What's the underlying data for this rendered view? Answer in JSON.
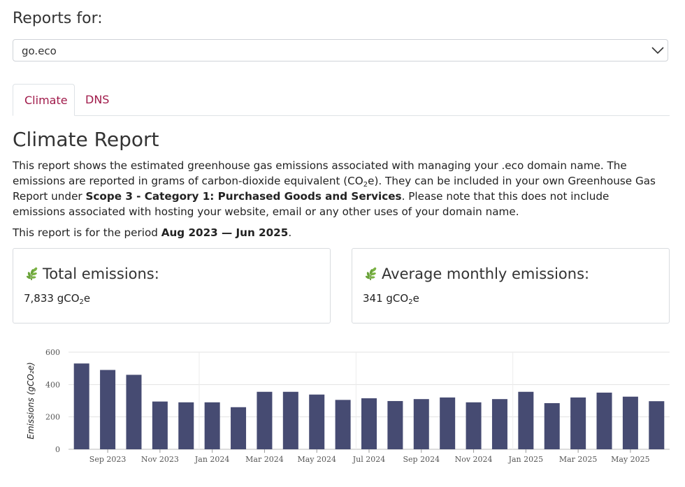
{
  "header": {
    "reports_label": "Reports for:"
  },
  "domain_select": {
    "value": "go.eco",
    "chevron_icon": "chevron-down-icon"
  },
  "tabs": [
    {
      "label": "Climate",
      "active": true
    },
    {
      "label": "DNS",
      "active": false
    }
  ],
  "report": {
    "title": "Climate Report",
    "desc_part1": "This report shows the estimated greenhouse gas emissions associated with managing your .eco domain name. The emissions are reported in grams of carbon-dioxide equivalent (CO",
    "desc_sub": "2",
    "desc_part2": "e). They can be included in your own Greenhouse Gas Report under ",
    "desc_bold": "Scope 3 - Category 1: Purchased Goods and Services",
    "desc_part3": ". Please note that this does not include emissions associated with hosting your website, email or any other uses of your domain name.",
    "period_prefix": "This report is for the period ",
    "period_value": "Aug 2023 — Jun 2025",
    "period_suffix": "."
  },
  "cards": {
    "leaf_icon": "leaf-icon",
    "total": {
      "title": "Total emissions:",
      "value": "7,833 gCO",
      "sub": "2",
      "suffix": "e"
    },
    "average": {
      "title": "Average monthly emissions:",
      "value": "341 gCO",
      "sub": "2",
      "suffix": "e"
    }
  },
  "colors": {
    "accent": "#a01a4a",
    "bar": "#464b72"
  },
  "chart_data": {
    "type": "bar",
    "ylabel": "Emissions (gCO₂e)",
    "ylim": [
      0,
      600
    ],
    "yticks": [
      0,
      200,
      400,
      600
    ],
    "grid": true,
    "categories": [
      "Aug 2023",
      "Sep 2023",
      "Oct 2023",
      "Nov 2023",
      "Dec 2023",
      "Jan 2024",
      "Feb 2024",
      "Mar 2024",
      "Apr 2024",
      "May 2024",
      "Jun 2024",
      "Jul 2024",
      "Aug 2024",
      "Sep 2024",
      "Oct 2024",
      "Nov 2024",
      "Dec 2024",
      "Jan 2025",
      "Feb 2025",
      "Mar 2025",
      "Apr 2025",
      "May 2025",
      "Jun 2025"
    ],
    "values": [
      530,
      490,
      460,
      295,
      290,
      290,
      260,
      355,
      355,
      338,
      305,
      315,
      298,
      310,
      320,
      290,
      310,
      355,
      285,
      320,
      350,
      325,
      297
    ],
    "xtick_labels": [
      "Sep 2023",
      "Nov 2023",
      "Jan 2024",
      "Mar 2024",
      "May 2024",
      "Jul 2024",
      "Sep 2024",
      "Nov 2024",
      "Jan 2025",
      "Mar 2025",
      "May 2025"
    ]
  }
}
